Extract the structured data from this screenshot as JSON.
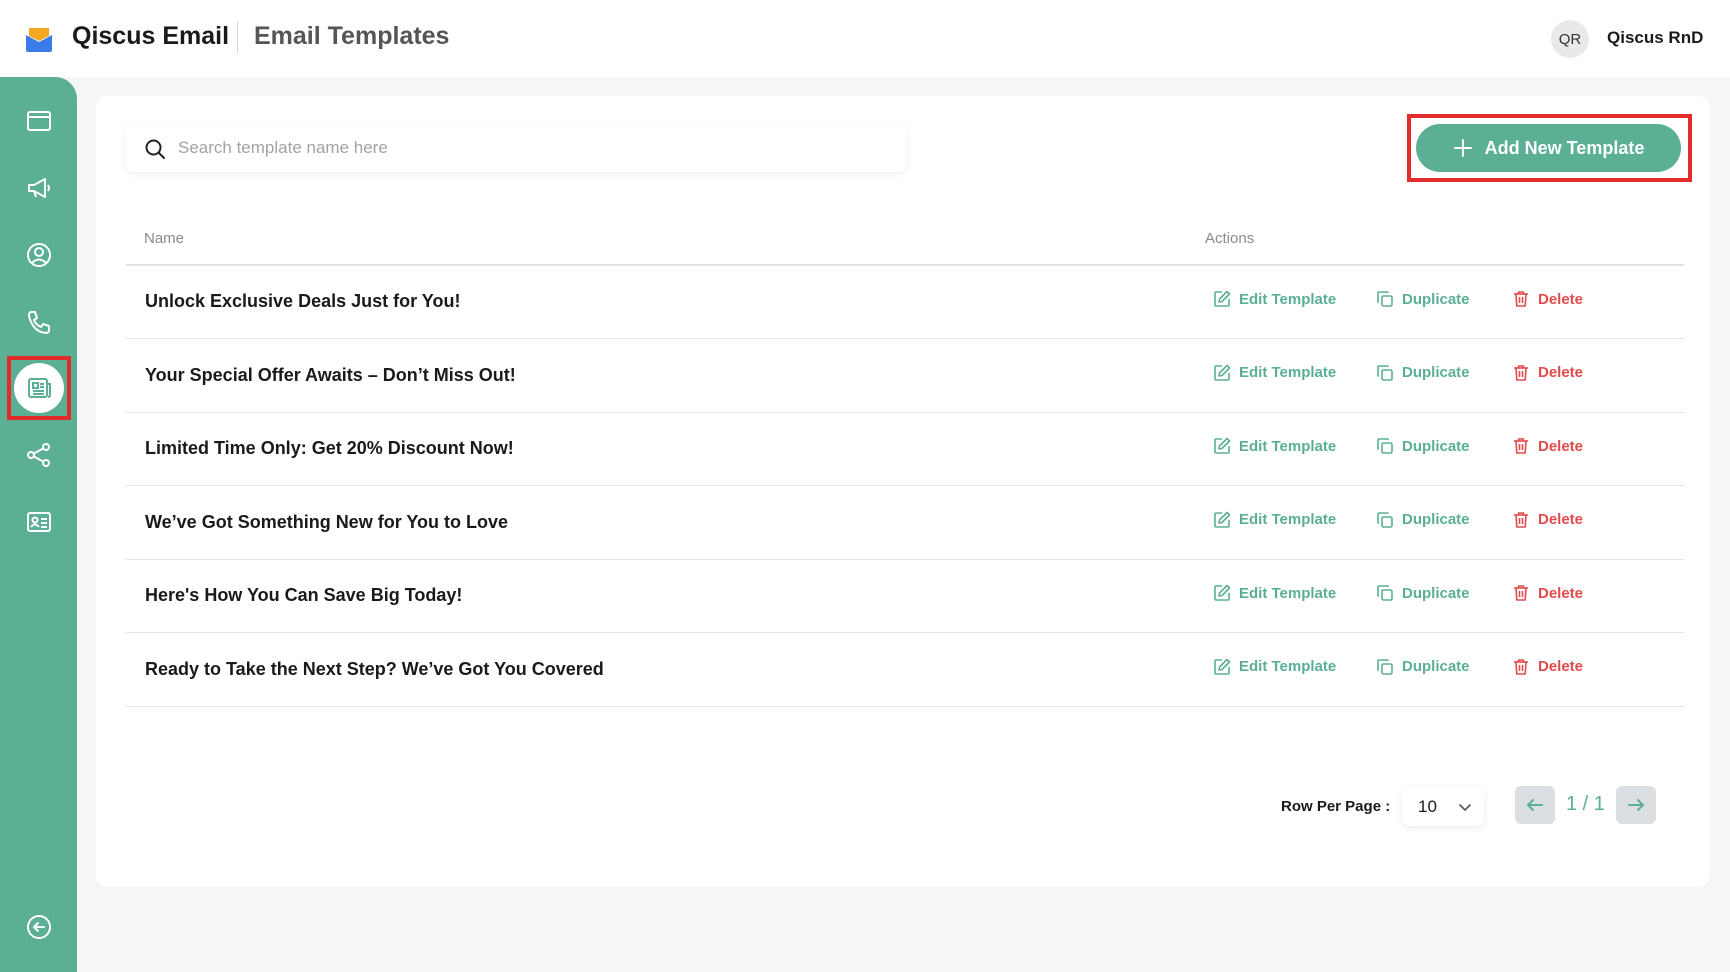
{
  "header": {
    "app_name": "Qiscus Email",
    "page_title": "Email Templates",
    "user_initials": "QR",
    "user_name": "Qiscus RnD"
  },
  "sidebar": {
    "items": [
      {
        "icon": "browser-window-icon"
      },
      {
        "icon": "megaphone-icon"
      },
      {
        "icon": "user-circle-icon"
      },
      {
        "icon": "phone-icon"
      },
      {
        "icon": "newspaper-template-icon",
        "active": true
      },
      {
        "icon": "share-nodes-icon"
      },
      {
        "icon": "contact-card-icon"
      }
    ],
    "collapse_icon": "arrow-left-circle-icon"
  },
  "search": {
    "placeholder": "Search template name here"
  },
  "toolbar": {
    "add_label": "Add New Template"
  },
  "table": {
    "columns": [
      "Name",
      "Actions"
    ],
    "rows": [
      {
        "name": "Unlock Exclusive Deals Just for You!"
      },
      {
        "name": "Your Special Offer Awaits – Don’t Miss Out!"
      },
      {
        "name": "Limited Time Only: Get 20% Discount Now!"
      },
      {
        "name": "We’ve Got Something New for You to Love"
      },
      {
        "name": "Here's How You Can Save Big Today!"
      },
      {
        "name": "Ready to Take the Next Step? We’ve Got You Covered"
      }
    ],
    "actions": {
      "edit": "Edit Template",
      "duplicate": "Duplicate",
      "delete": "Delete"
    }
  },
  "pagination": {
    "rows_per_page_label": "Row Per Page :",
    "rows_per_page_value": "10",
    "page_info": "1 / 1"
  },
  "colors": {
    "accent": "#5aaf95",
    "danger": "#e24b4b",
    "highlight": "#e32b2b"
  }
}
